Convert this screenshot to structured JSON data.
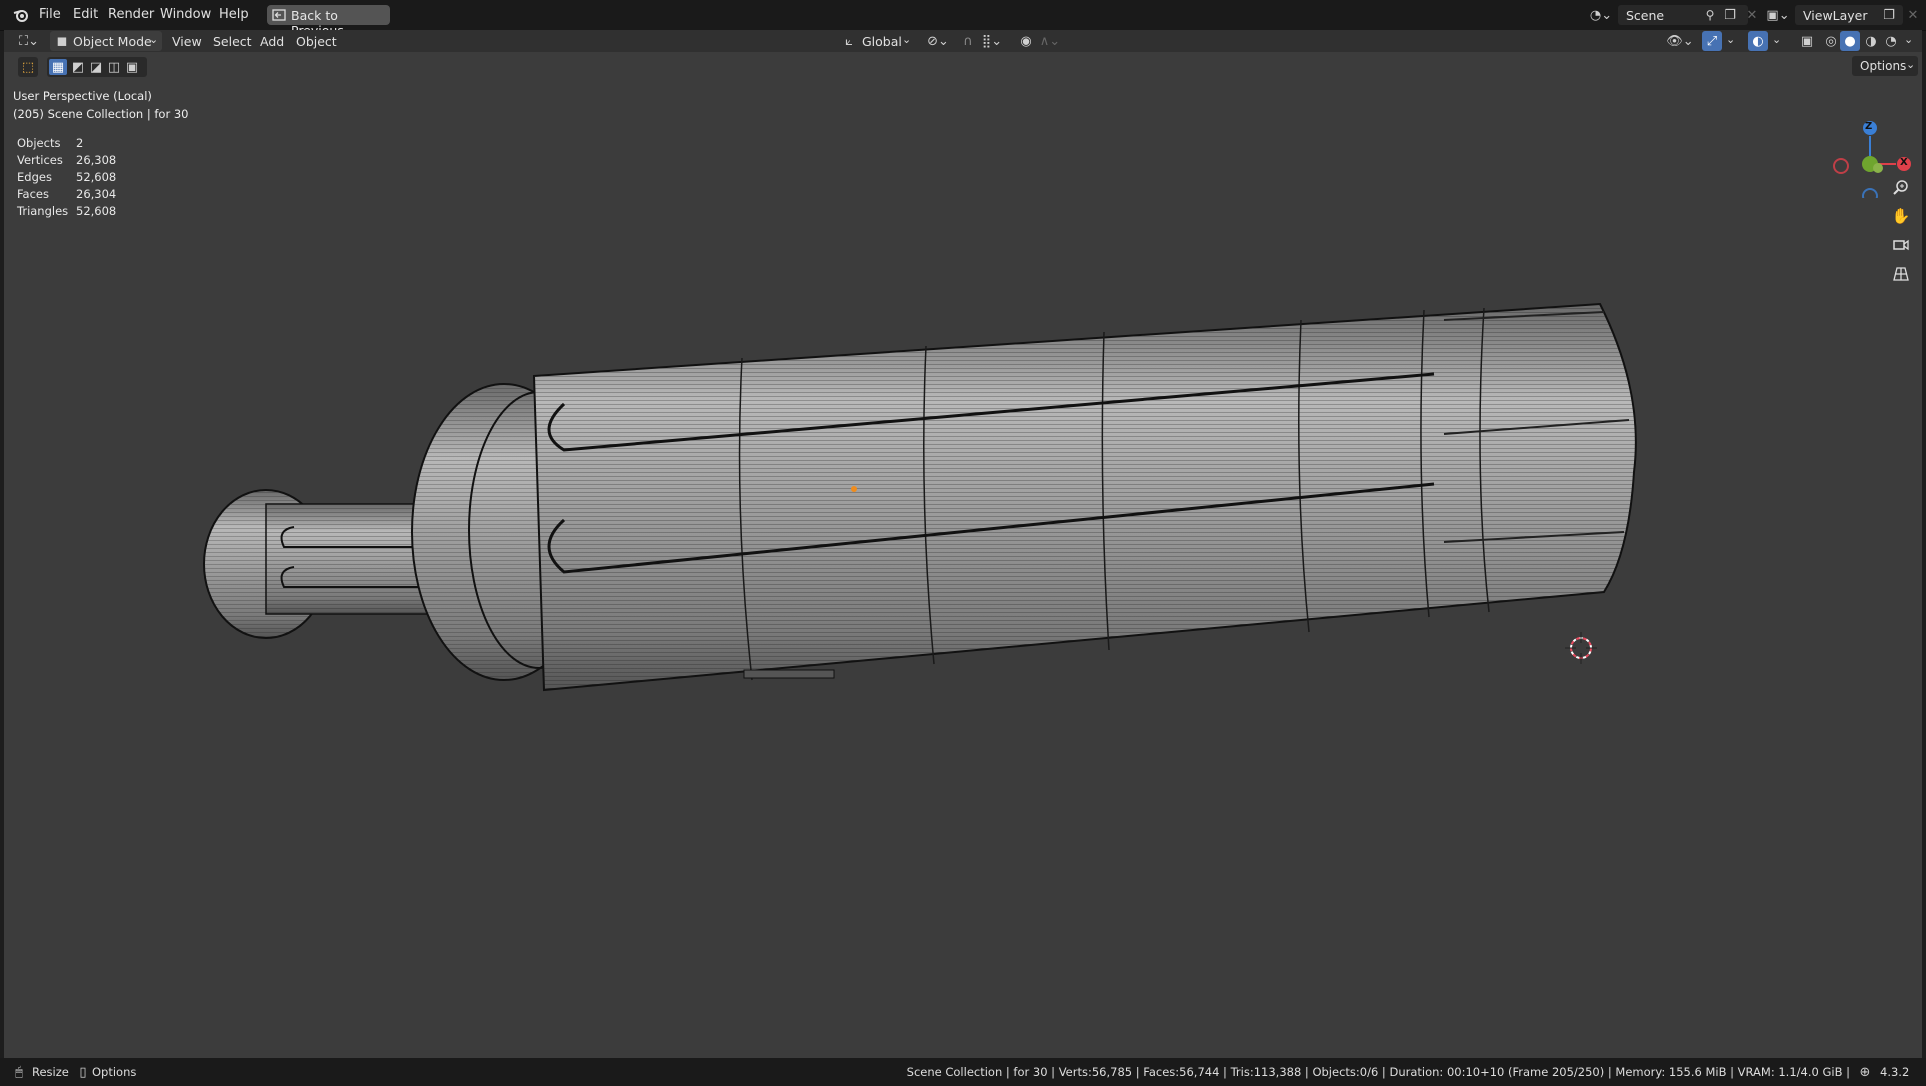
{
  "menu": {
    "file": "File",
    "edit": "Edit",
    "render": "Render",
    "window": "Window",
    "help": "Help",
    "back_to_previous": "Back to Previous"
  },
  "scene": {
    "label": "Scene",
    "view_layer": "ViewLayer"
  },
  "header": {
    "mode": "Object Mode",
    "view": "View",
    "select": "Select",
    "add": "Add",
    "object": "Object",
    "transform_orientation": "Global",
    "options": "Options"
  },
  "overlay": {
    "perspective": "User Perspective (Local)",
    "collection": "(205) Scene Collection | for 30",
    "stats": [
      {
        "label": "Objects",
        "value": "2"
      },
      {
        "label": "Vertices",
        "value": "26,308"
      },
      {
        "label": "Edges",
        "value": "52,608"
      },
      {
        "label": "Faces",
        "value": "26,304"
      },
      {
        "label": "Triangles",
        "value": "52,608"
      }
    ]
  },
  "gizmo": {
    "z": "Z",
    "x": "X"
  },
  "statusbar": {
    "resize": "Resize",
    "options": "Options",
    "info": "Scene Collection | for 30 | Verts:56,785 | Faces:56,744 | Tris:113,388 | Objects:0/6 | Duration: 00:10+10 (Frame 205/250) | Memory: 155.6 MiB | VRAM: 1.1/4.0 GiB |",
    "version": "4.3.2"
  },
  "colors": {
    "viewport": "#3c3c3c",
    "accent": "#4772b3",
    "x_axis": "#e0404a",
    "y_axis": "#6fa52e",
    "z_axis": "#3a7fd6"
  }
}
